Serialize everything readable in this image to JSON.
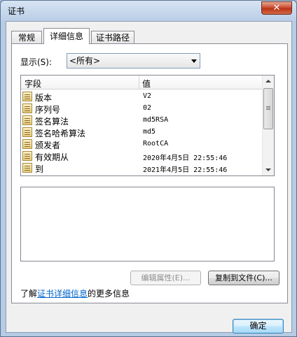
{
  "window": {
    "title": "证书",
    "close_label": "✕"
  },
  "tabs": [
    {
      "label": "常规"
    },
    {
      "label": "详细信息"
    },
    {
      "label": "证书路径"
    }
  ],
  "show": {
    "label": "显示(S):",
    "value": "<所有>"
  },
  "list": {
    "columns": [
      "字段",
      "值"
    ],
    "rows": [
      {
        "field": "版本",
        "value": "V2"
      },
      {
        "field": "序列号",
        "value": "02"
      },
      {
        "field": "签名算法",
        "value": "md5RSA"
      },
      {
        "field": "签名哈希算法",
        "value": "md5"
      },
      {
        "field": "颁发者",
        "value": "RootCA"
      },
      {
        "field": "有效期从",
        "value": "2020年4月5日 22:55:46"
      },
      {
        "field": "到",
        "value": "2021年4月5日 22:55:46"
      }
    ]
  },
  "buttons": {
    "edit_properties": "编辑属性(E)...",
    "copy_to_file": "复制到文件(C)...",
    "ok": "确定"
  },
  "info": {
    "prefix": "了解",
    "link": "证书详细信息",
    "suffix": "的更多信息"
  }
}
